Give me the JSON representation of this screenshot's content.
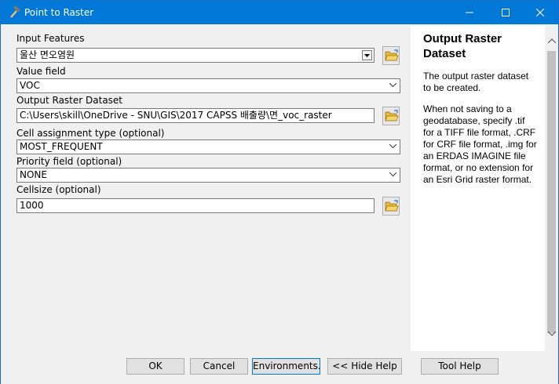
{
  "window": {
    "title": "Point to Raster"
  },
  "form": {
    "input_features": {
      "label": "Input Features",
      "value": "울산 면오염원"
    },
    "value_field": {
      "label": "Value field",
      "value": "VOC"
    },
    "output_raster": {
      "label": "Output Raster Dataset",
      "value": "C:\\Users\\skill\\OneDrive - SNU\\GIS\\2017 CAPSS 배출량\\면_voc_raster"
    },
    "cell_assignment": {
      "label": "Cell assignment type (optional)",
      "value": "MOST_FREQUENT"
    },
    "priority_field": {
      "label": "Priority field (optional)",
      "value": "NONE"
    },
    "cellsize": {
      "label": "Cellsize (optional)",
      "value": "1000"
    }
  },
  "help": {
    "title": "Output Raster Dataset",
    "p1": "The output raster dataset to be created.",
    "p2": "When not saving to a geodatabase, specify .tif for a TIFF file format, .CRF for CRF file format, .img for an ERDAS IMAGINE file format, or no extension for an Esri Grid raster format."
  },
  "buttons": {
    "ok": "OK",
    "cancel": "Cancel",
    "environments": "Environments...",
    "hide_help": "<< Hide Help",
    "tool_help": "Tool Help"
  },
  "colors": {
    "titlebar": "#0078d7",
    "accent_border": "#0078d7"
  }
}
